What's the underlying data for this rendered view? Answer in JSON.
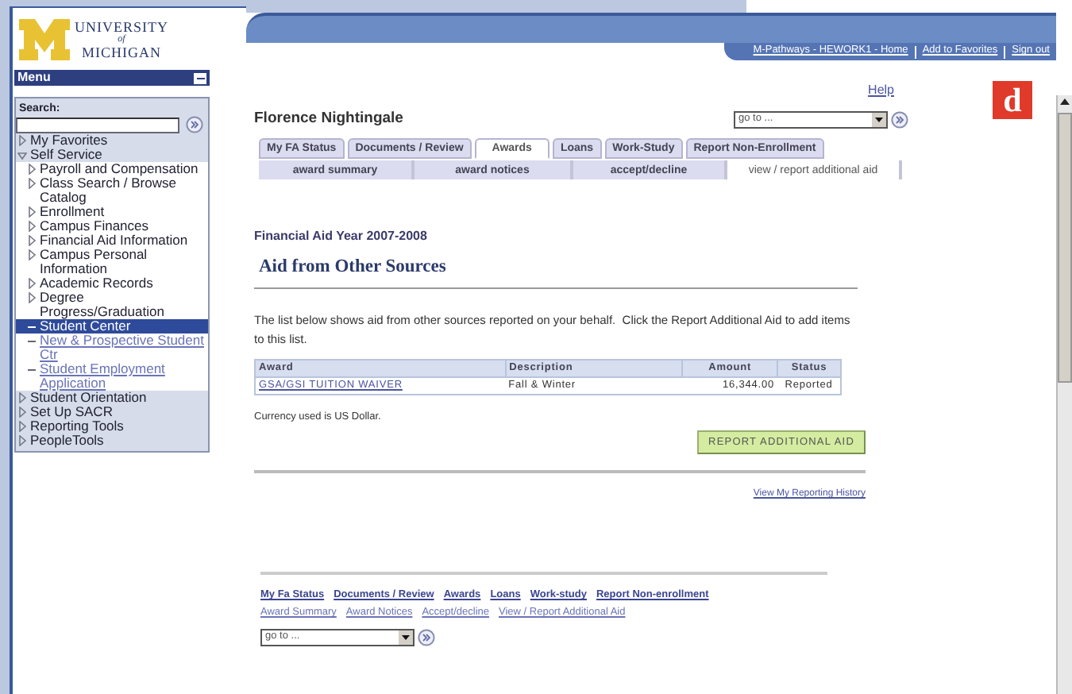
{
  "header": {
    "links": [
      "M-Pathways - HEWORK1 - Home",
      "Add to Favorites",
      "Sign out"
    ]
  },
  "logo": {
    "line1": "UNIVERSITY",
    "line2": "of",
    "line3": "MICHIGAN"
  },
  "menu": {
    "title": "Menu",
    "search_label": "Search:",
    "items": [
      {
        "label": "My Favorites",
        "kind": "folder",
        "expanded": false,
        "selected": false
      },
      {
        "label": "Self Service",
        "kind": "folder",
        "expanded": true,
        "selected": false,
        "children": [
          {
            "label": "Payroll and Compensation",
            "kind": "folder",
            "expanded": false,
            "selected": false
          },
          {
            "label": "Class Search / Browse Catalog",
            "kind": "folder",
            "expanded": false,
            "selected": false
          },
          {
            "label": "Enrollment",
            "kind": "folder",
            "expanded": false,
            "selected": false
          },
          {
            "label": "Campus Finances",
            "kind": "folder",
            "expanded": false,
            "selected": false
          },
          {
            "label": "Financial Aid Information",
            "kind": "folder",
            "expanded": false,
            "selected": false
          },
          {
            "label": "Campus Personal Information",
            "kind": "folder",
            "expanded": false,
            "selected": false
          },
          {
            "label": "Academic Records",
            "kind": "folder",
            "expanded": false,
            "selected": false
          },
          {
            "label": "Degree Progress/Graduation",
            "kind": "folder",
            "expanded": false,
            "selected": false
          },
          {
            "label": "Student Center",
            "kind": "link",
            "selected": true
          },
          {
            "label": "New & Prospective Student Ctr",
            "kind": "link",
            "selected": false
          },
          {
            "label": "Student Employment Application",
            "kind": "link",
            "selected": false
          }
        ]
      },
      {
        "label": "Student Orientation",
        "kind": "folder",
        "expanded": false,
        "selected": false
      },
      {
        "label": "Set Up SACR",
        "kind": "folder",
        "expanded": false,
        "selected": false
      },
      {
        "label": "Reporting Tools",
        "kind": "folder",
        "expanded": false,
        "selected": false
      },
      {
        "label": "PeopleTools",
        "kind": "folder",
        "expanded": false,
        "selected": false
      }
    ]
  },
  "help": "Help",
  "student_name": "Florence Nightingale",
  "goto": {
    "value": "go to ..."
  },
  "panel_label": "d",
  "tabs": [
    {
      "label": "My FA Status",
      "selected": false
    },
    {
      "label": "Documents / Review",
      "selected": false
    },
    {
      "label": "Awards",
      "selected": true
    },
    {
      "label": "Loans",
      "selected": false
    },
    {
      "label": "Work-Study",
      "selected": false
    },
    {
      "label": "Report Non-Enrollment",
      "selected": false
    }
  ],
  "subtabs": [
    {
      "label": "award summary",
      "selected": false
    },
    {
      "label": "award notices",
      "selected": false
    },
    {
      "label": "accept/decline",
      "selected": false
    },
    {
      "label": "view / report additional aid",
      "selected": true
    }
  ],
  "aid_year": "Financial Aid Year 2007-2008",
  "section_title": "Aid from Other Sources",
  "intro": "The list below shows aid from other sources reported on your behalf.  Click the Report Additional Aid to add items to this list.",
  "table": {
    "columns": [
      "Award",
      "Description",
      "Amount",
      "Status"
    ],
    "rows": [
      [
        "GSA/GSI TUITION WAIVER",
        "Fall & Winter",
        "16,344.00",
        "Reported"
      ]
    ]
  },
  "currency_note": "Currency used is US Dollar.",
  "report_button": "REPORT ADDITIONAL AID",
  "history_link": "View My Reporting History",
  "footer": {
    "tab_links": [
      "My Fa Status",
      "Documents / Review",
      "Awards",
      "Loans",
      "Work-study",
      "Report Non-enrollment"
    ],
    "subtab_links": [
      "Award Summary",
      "Award Notices",
      "Accept/decline",
      "View / Report Additional Aid"
    ],
    "goto": {
      "value": "go to ..."
    }
  }
}
